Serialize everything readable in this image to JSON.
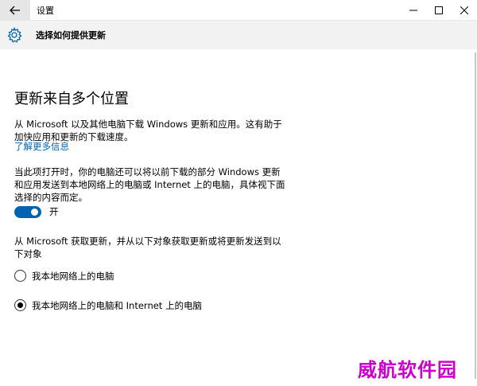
{
  "window": {
    "title": "设置"
  },
  "header": {
    "title": "选择如何提供更新"
  },
  "main": {
    "section_title": "更新来自多个位置",
    "description": "从 Microsoft 以及其他电脑下载 Windows 更新和应用。这有助于加快应用和更新的下载速度。",
    "learn_more_link": "了解更多信息",
    "toggle_description": "当此项打开时，你的电脑还可以将以前下载的部分 Windows 更新和应用发送到本地网络上的电脑或 Internet 上的电脑，具体视下面选择的内容而定。",
    "toggle": {
      "state_label": "开",
      "on": true
    },
    "source_description": "从 Microsoft 获取更新，并从以下对象获取更新或将更新发送到以下对象",
    "options": [
      {
        "label": "我本地网络上的电脑",
        "selected": false
      },
      {
        "label": "我本地网络上的电脑和 Internet 上的电脑",
        "selected": true
      }
    ]
  },
  "watermark": "威航软件园",
  "colors": {
    "accent": "#0063b1",
    "header_bg": "#f2f2f2",
    "watermark": "#cc00cc"
  },
  "icons": {
    "back": "arrow-left-icon",
    "settings": "gear-icon",
    "minimize": "minimize-icon",
    "maximize": "maximize-icon",
    "close": "close-icon"
  }
}
